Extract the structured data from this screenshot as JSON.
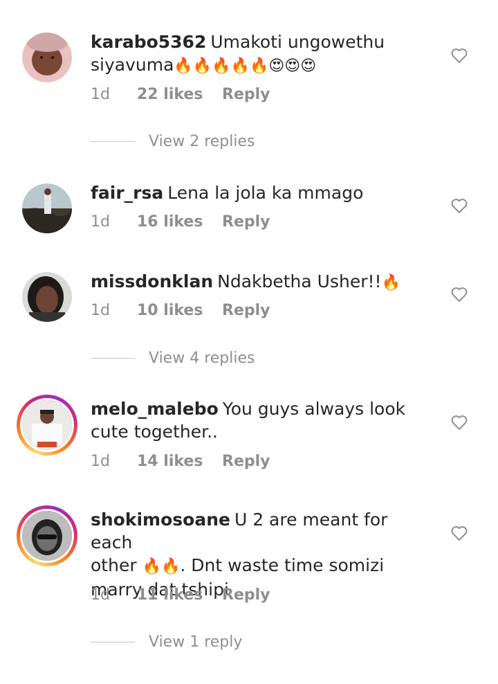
{
  "comments": [
    {
      "username": "karabo5362",
      "text_line1": "Umakoti ungowethu",
      "text_line2": "siyavuma",
      "emojis": "🔥🔥🔥🔥🔥😍😍😍",
      "time": "1d",
      "likes": "22 likes",
      "reply": "Reply",
      "view_replies": "View 2 replies",
      "heart_icon": "heart-outline-icon"
    },
    {
      "username": "fair_rsa",
      "text_line1": "Lena la jola ka mmago",
      "time": "1d",
      "likes": "16 likes",
      "reply": "Reply",
      "heart_icon": "heart-outline-icon"
    },
    {
      "username": "missdonklan",
      "text_line1": "Ndakbetha Usher!!",
      "emojis": "🔥",
      "time": "1d",
      "likes": "10 likes",
      "reply": "Reply",
      "view_replies": "View 4 replies",
      "heart_icon": "heart-outline-icon"
    },
    {
      "username": "melo_malebo",
      "text_line1": "You guys always look",
      "text_line2": "cute together..",
      "time": "1d",
      "likes": "14 likes",
      "reply": "Reply",
      "heart_icon": "heart-outline-icon"
    },
    {
      "username": "shokimosoane",
      "text_line1": "U 2 are meant for each",
      "text_line2_pre": "other",
      "emojis": "🔥🔥",
      "text_line2_post": ". Dnt waste time somizi",
      "text_line3": "marry dat tshipi",
      "time": "1d",
      "likes": "11 likes",
      "reply": "Reply",
      "view_replies": "View 1 reply",
      "heart_icon": "heart-outline-icon"
    }
  ],
  "colors": {
    "text": "#262626",
    "secondary": "#8e8e8e",
    "story_ring": [
      "#feda75",
      "#fa7e1e",
      "#d62976",
      "#962fbf"
    ]
  }
}
